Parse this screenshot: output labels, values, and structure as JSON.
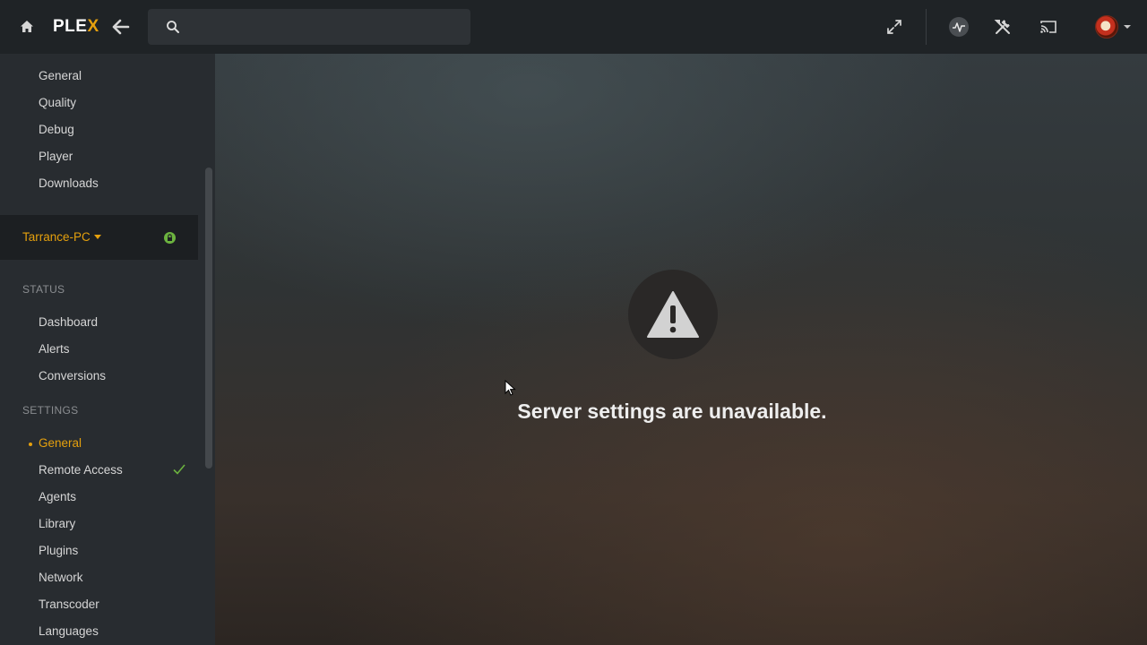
{
  "topbar": {
    "logo_main": "PLE",
    "logo_accent": "X",
    "search_placeholder": "",
    "search_value": ""
  },
  "sidebar": {
    "top_items": [
      {
        "label": "General"
      },
      {
        "label": "Quality"
      },
      {
        "label": "Debug"
      },
      {
        "label": "Player"
      },
      {
        "label": "Downloads"
      }
    ],
    "server": {
      "name": "Tarrance-PC"
    },
    "status_header": "STATUS",
    "status_items": [
      {
        "label": "Dashboard"
      },
      {
        "label": "Alerts"
      },
      {
        "label": "Conversions"
      }
    ],
    "settings_header": "SETTINGS",
    "settings_items": [
      {
        "label": "General",
        "active": true
      },
      {
        "label": "Remote Access",
        "checked": true
      },
      {
        "label": "Agents"
      },
      {
        "label": "Library"
      },
      {
        "label": "Plugins"
      },
      {
        "label": "Network"
      },
      {
        "label": "Transcoder"
      },
      {
        "label": "Languages"
      }
    ]
  },
  "main": {
    "message": "Server settings are unavailable.",
    "icon": "warning-icon"
  },
  "colors": {
    "accent": "#e5a00d",
    "success": "#6cb33f",
    "topbar_bg": "#1f2326",
    "sidebar_bg": "#282c30"
  },
  "icons": [
    "home-icon",
    "back-arrow-icon",
    "search-icon",
    "fullscreen-icon",
    "activity-icon",
    "settings-tools-icon",
    "cast-icon",
    "avatar",
    "caret-down-icon",
    "lock-icon",
    "check-icon",
    "warning-icon",
    "mouse-cursor"
  ]
}
